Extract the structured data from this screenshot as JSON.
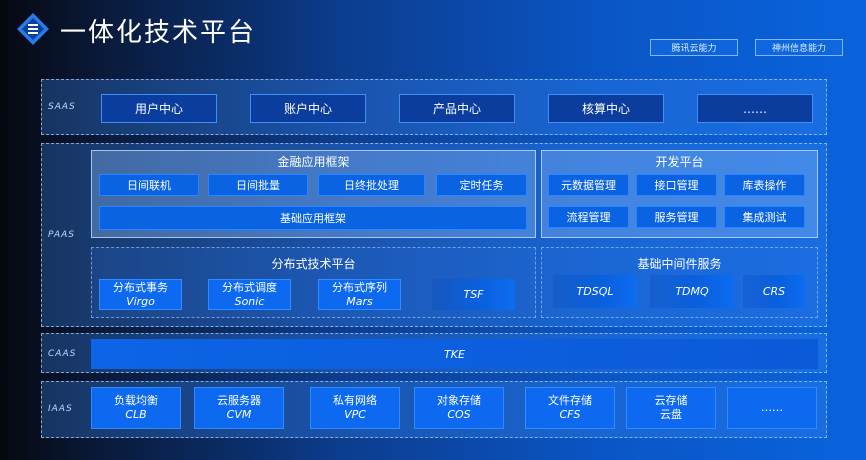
{
  "header": {
    "title": "一体化技术平台",
    "tags": [
      "腾讯云能力",
      "神州信息能力"
    ]
  },
  "saas": {
    "label": "SAAS",
    "items": [
      "用户中心",
      "账户中心",
      "产品中心",
      "核算中心",
      "……"
    ]
  },
  "paas": {
    "label": "PAAS",
    "finance": {
      "title": "金融应用框架",
      "items": [
        "日间联机",
        "日间批量",
        "日终批处理",
        "定时任务"
      ],
      "base": "基础应用框架"
    },
    "dev": {
      "title": "开发平台",
      "items": [
        "元数据管理",
        "接口管理",
        "库表操作",
        "流程管理",
        "服务管理",
        "集成测试"
      ]
    },
    "distributed": {
      "title": "分布式技术平台",
      "items": [
        {
          "line1": "分布式事务",
          "line2": "Virgo"
        },
        {
          "line1": "分布式调度",
          "line2": "Sonic"
        },
        {
          "line1": "分布式序列",
          "line2": "Mars"
        }
      ],
      "tsf": "TSF"
    },
    "middleware": {
      "title": "基础中间件服务",
      "items": [
        "TDSQL",
        "TDMQ",
        "CRS"
      ]
    }
  },
  "caas": {
    "label": "CAAS",
    "item": "TKE"
  },
  "iaas": {
    "label": "IAAS",
    "items": [
      {
        "line1": "负载均衡",
        "line2": "CLB"
      },
      {
        "line1": "云服务器",
        "line2": "CVM"
      },
      {
        "line1": "私有网络",
        "line2": "VPC"
      },
      {
        "line1": "对象存储",
        "line2": "COS"
      },
      {
        "line1": "文件存储",
        "line2": "CFS"
      },
      {
        "line1": "云存储",
        "line2": "云盘"
      },
      {
        "line1": "……",
        "line2": ""
      }
    ]
  }
}
